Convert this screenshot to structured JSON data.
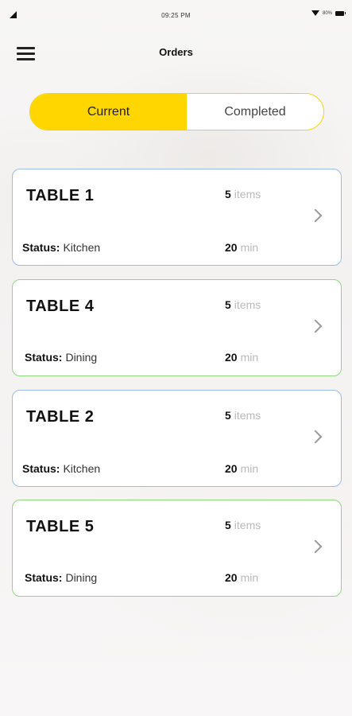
{
  "status_bar": {
    "time": "09:25 PM",
    "battery": "80%"
  },
  "header": {
    "title": "Orders",
    "menu_icon": "hamburger-menu-icon"
  },
  "tabs": {
    "current": "Current",
    "completed": "Completed",
    "active": "current",
    "accent_color": "#ffd600"
  },
  "orders": [
    {
      "table": "TABLE 1",
      "items_count": "5",
      "items_unit": "items",
      "status_label": "Status:",
      "status": "Kitchen",
      "time": "20",
      "time_unit": "min",
      "border_color": "#9bbbea"
    },
    {
      "table": "TABLE 4",
      "items_count": "5",
      "items_unit": "items",
      "status_label": "Status:",
      "status": "Dining",
      "time": "20",
      "time_unit": "min",
      "border_color": "#8fd77f"
    },
    {
      "table": "TABLE 2",
      "items_count": "5",
      "items_unit": "items",
      "status_label": "Status:",
      "status": "Kitchen",
      "time": "20",
      "time_unit": "min",
      "border_color": "#9bbbea"
    },
    {
      "table": "TABLE 5",
      "items_count": "5",
      "items_unit": "items",
      "status_label": "Status:",
      "status": "Dining",
      "time": "20",
      "time_unit": "min",
      "border_color": "#8fd77f"
    }
  ]
}
